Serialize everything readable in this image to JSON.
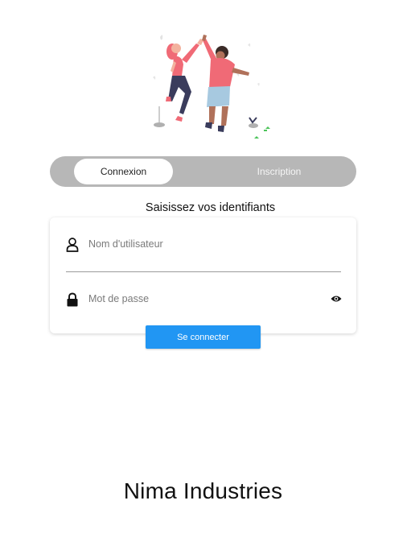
{
  "illustration": {
    "name": "high-five-illustration"
  },
  "tabs": [
    {
      "label": "Connexion",
      "active": true
    },
    {
      "label": "Inscription",
      "active": false
    }
  ],
  "form": {
    "heading": "Saisissez vos identifiants",
    "username": {
      "placeholder": "Nom d'utilisateur",
      "value": "",
      "icon": "person-icon"
    },
    "password": {
      "placeholder": "Mot de passe",
      "value": "",
      "icon": "lock-icon",
      "toggle_icon": "eye-icon"
    },
    "submit_label": "Se connecter"
  },
  "brand": "Nima Industries",
  "colors": {
    "accent": "#2196f3",
    "segment_bg": "#b7b7b7",
    "illustration_red": "#f06a76",
    "illustration_navy": "#3a3c5c"
  }
}
